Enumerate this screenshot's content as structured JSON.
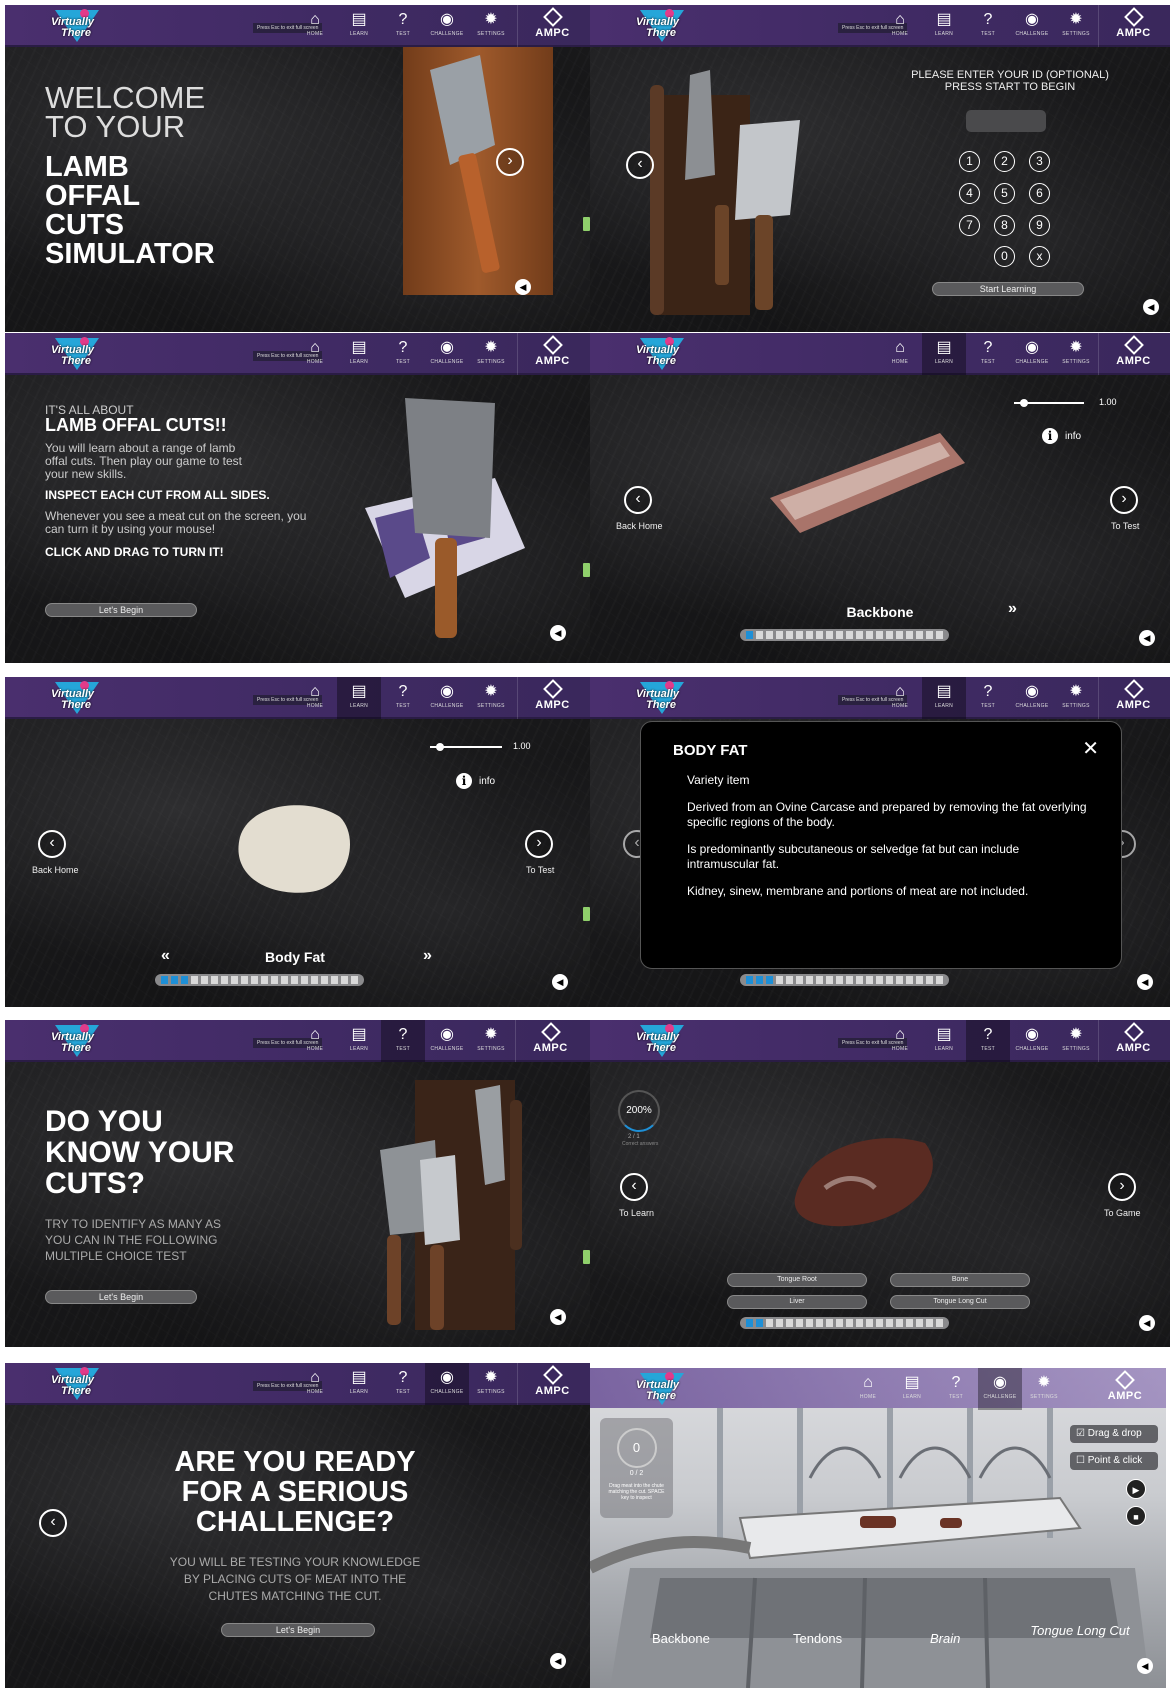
{
  "brand": {
    "logo_line1": "Virtually",
    "logo_line2": "There",
    "ampc": "AMPC",
    "esc_note": "Press  Esc  to exit full screen"
  },
  "nav": {
    "home": "HOME",
    "learn": "LEARN",
    "test": "TEST",
    "challenge": "CHALLENGE",
    "settings": "SETTINGS"
  },
  "icons": {
    "home": "home-icon",
    "learn": "book-icon",
    "test": "question-icon",
    "challenge": "gamepad-icon",
    "settings": "gear-icon",
    "sound": "speaker-icon"
  },
  "colors": {
    "purple_bar": "#4a2f6e",
    "accent_blue": "#1e8fd6"
  },
  "welcome": {
    "line1": "WELCOME",
    "line2": "TO YOUR",
    "title": [
      "LAMB",
      "OFFAL",
      "CUTS",
      "SIMULATOR"
    ]
  },
  "login": {
    "line1": "PLEASE ENTER YOUR ID (OPTIONAL)",
    "line2": "PRESS START TO BEGIN",
    "keys": [
      "1",
      "2",
      "3",
      "4",
      "5",
      "6",
      "7",
      "8",
      "9",
      "0",
      "x"
    ],
    "start": "Start Learning"
  },
  "intro": {
    "kicker": "IT'S ALL ABOUT",
    "title": "LAMB OFFAL CUTS!!",
    "p1": "You will learn about a range of lamb offal cuts. Then play our game to test your new skills.",
    "b1": "INSPECT EACH CUT FROM ALL SIDES.",
    "p2": "Whenever you see a meat cut on the screen, you can turn it by using your mouse!",
    "b2": "CLICK AND DRAG TO TURN IT!",
    "cta": "Let's Begin"
  },
  "learn": {
    "zoom": "1.00",
    "info": "info",
    "back": "Back Home",
    "next": "To Test",
    "item_a": "Backbone",
    "item_b": "Body Fat",
    "prev_glyph": "«",
    "next_glyph": "»",
    "progress_on_a": 1,
    "progress_on_b": 3,
    "progress_total": 20
  },
  "body_fat_modal": {
    "title": "BODY FAT",
    "type": "Variety item",
    "p1": "Derived from an Ovine Carcase and prepared by removing the fat overlying specific regions of the body.",
    "p2": "Is predominantly subcutaneous or selvedge fat but can include intramuscular fat.",
    "p3": "Kidney, sinew, membrane and portions of meat are not included."
  },
  "test_intro": {
    "title": [
      "DO YOU",
      "KNOW YOUR",
      "CUTS?"
    ],
    "body": [
      "TRY TO IDENTIFY AS MANY AS",
      "YOU CAN IN THE FOLLOWING",
      "MULTIPLE CHOICE TEST"
    ],
    "cta": "Let's Begin"
  },
  "test": {
    "score": "200%",
    "count": "2 / 1",
    "count_label": "Correct answers",
    "back": "To Learn",
    "next": "To Game",
    "options": [
      "Tongue Root",
      "Bone",
      "Liver",
      "Tongue Long Cut"
    ]
  },
  "challenge_intro": {
    "title": [
      "ARE YOU READY",
      "FOR A SERIOUS",
      "CHALLENGE?"
    ],
    "body": [
      "YOU WILL BE TESTING YOUR KNOWLEDGE",
      "BY PLACING CUTS OF MEAT INTO THE",
      "CHUTES MATCHING THE CUT."
    ],
    "cta": "Let's Begin"
  },
  "game": {
    "score": "0",
    "count": "0 / 2",
    "hint": "Drag meat into the chute matching the cut. SPACE key to inspect",
    "mode1": "Drag & drop",
    "mode2": "Point & click",
    "chutes": [
      "Backbone",
      "Tendons",
      "Brain",
      "Tongue Long Cut"
    ]
  }
}
